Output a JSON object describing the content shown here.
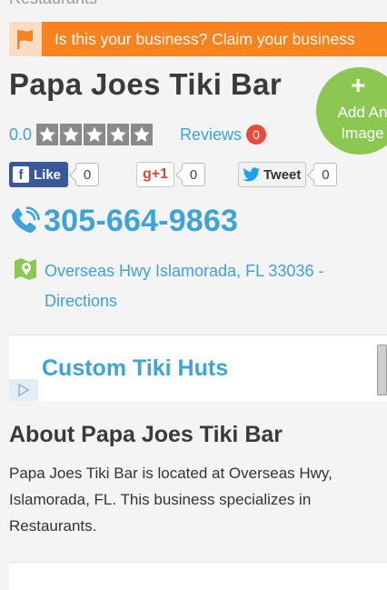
{
  "breadcrumb": {
    "current": "Restaurants"
  },
  "claim_banner": {
    "text": "Is this your business? Claim your business"
  },
  "business": {
    "name": "Papa Joes Tiki Bar",
    "rating": "0.0",
    "stars_filled": 0,
    "stars_total": 5,
    "reviews_label": "Reviews",
    "reviews_count": "0",
    "phone": "305-664-9863",
    "address": "Overseas Hwy Islamorada, FL 33036 - Directions"
  },
  "add_image": {
    "plus": "+",
    "label": "Add An Image"
  },
  "social": {
    "facebook": {
      "label": "Like",
      "icon": "f",
      "count": "0"
    },
    "google_plus": {
      "label": "g+1",
      "count": "0"
    },
    "twitter": {
      "label": "Tweet",
      "count": "0"
    }
  },
  "ad": {
    "title": "Custom Tiki Huts"
  },
  "about": {
    "heading": "About Papa Joes Tiki Bar",
    "body": "Papa Joes Tiki Bar is located at Overseas Hwy, Islamorada, FL. This business specializes in Restaurants."
  },
  "colors": {
    "accent_blue": "#3ea3d6",
    "banner_orange": "#f7821e",
    "add_image_green": "#8cc751",
    "badge_red": "#e84b3c",
    "facebook_blue": "#3b5998"
  },
  "icons": {
    "flag": "flag-icon",
    "phone": "phone-icon",
    "map": "map-icon",
    "star": "star-icon",
    "ad_choices": "ad-play-icon"
  }
}
